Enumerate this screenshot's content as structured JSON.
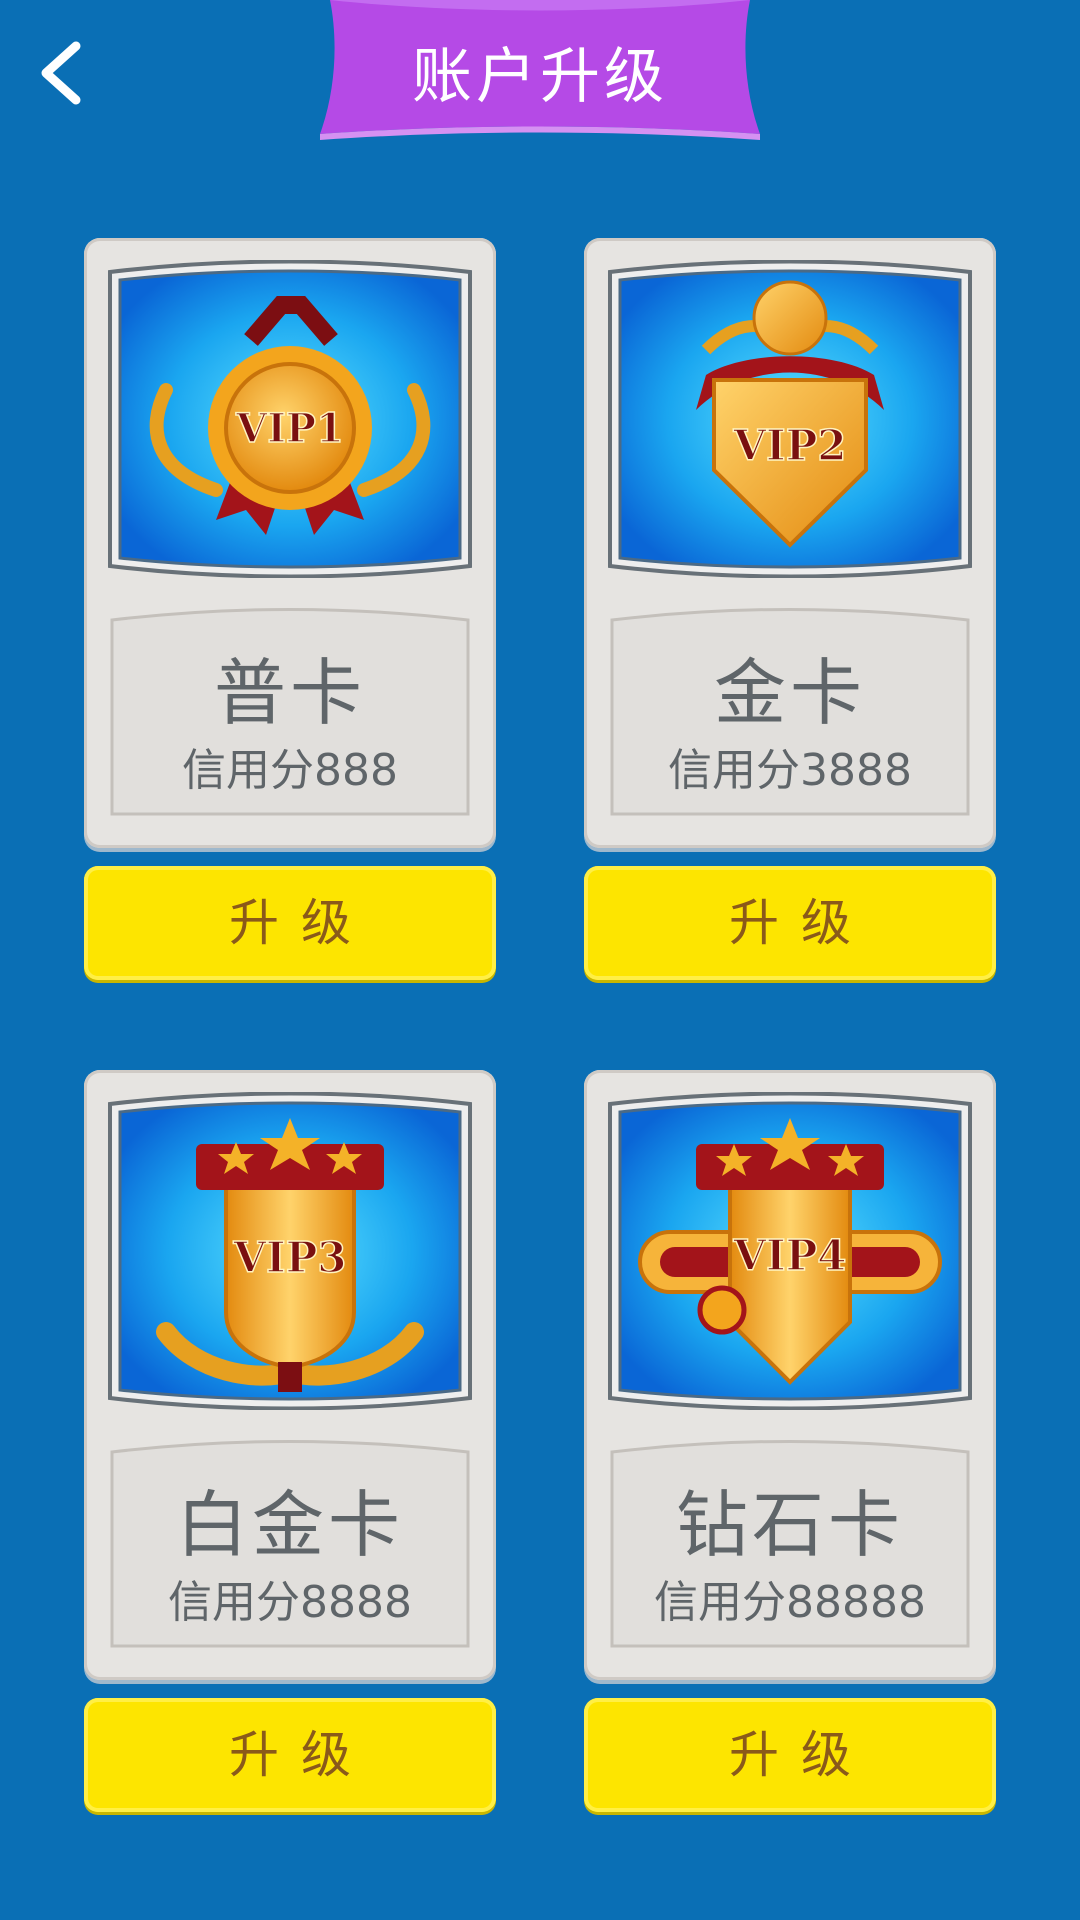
{
  "header": {
    "title": "账户升级"
  },
  "cards": [
    {
      "badge": "VIP1",
      "name": "普卡",
      "credit": "信用分888",
      "button": "升级"
    },
    {
      "badge": "VIP2",
      "name": "金卡",
      "credit": "信用分3888",
      "button": "升级"
    },
    {
      "badge": "VIP3",
      "name": "白金卡",
      "credit": "信用分8888",
      "button": "升级"
    },
    {
      "badge": "VIP4",
      "name": "钻石卡",
      "credit": "信用分88888",
      "button": "升级"
    }
  ],
  "colors": {
    "background": "#0a6fb5",
    "banner": "#b54ae6",
    "button": "#fde500",
    "button_text": "#8a5a1a",
    "card_text": "#5f6569"
  },
  "icons": {
    "back": "chevron-left-icon"
  }
}
